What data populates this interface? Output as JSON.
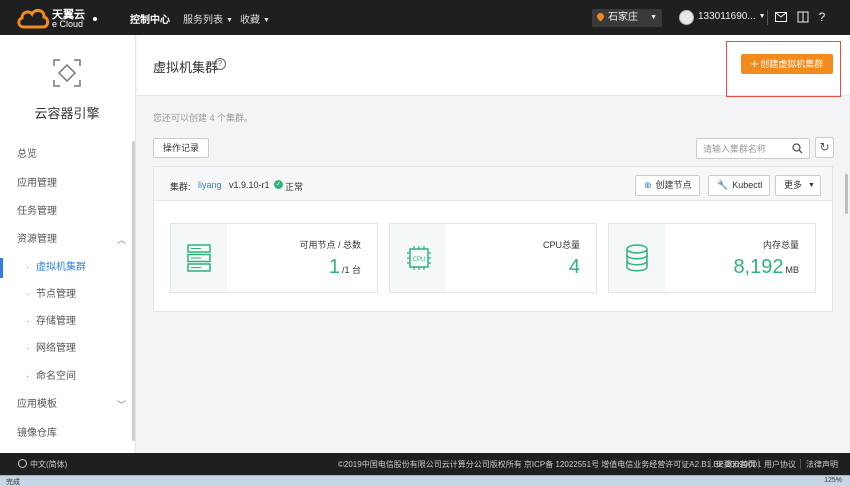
{
  "header": {
    "brand_cn": "天翼云",
    "brand_en": "e Cloud",
    "nav_console": "控制中心",
    "nav_services": "服务列表",
    "nav_favorites": "收藏",
    "region": "石家庄",
    "user": "133011690...",
    "icons": [
      "mail-icon",
      "book-icon",
      "help-icon"
    ]
  },
  "sidebar": {
    "title": "云容器引擎",
    "items": [
      {
        "label": "总览"
      },
      {
        "label": "应用管理"
      },
      {
        "label": "任务管理"
      },
      {
        "label": "资源管理",
        "expanded": true
      },
      {
        "label": "虚拟机集群",
        "active": true
      },
      {
        "label": "节点管理"
      },
      {
        "label": "存储管理"
      },
      {
        "label": "网络管理"
      },
      {
        "label": "命名空间"
      },
      {
        "label": "应用模板",
        "expanded": false
      },
      {
        "label": "镜像仓库"
      }
    ]
  },
  "page": {
    "title": "虚拟机集群",
    "create_button": "创建虚拟机集群",
    "quota_text": "您还可以创建 4 个集群。",
    "ops_log_button": "操作记录",
    "search_placeholder": "请输入集群名称"
  },
  "cluster": {
    "label": "集群:",
    "name": "liyang",
    "version": "v1.9.10-r1",
    "status": "正常",
    "btn_create_node": "创建节点",
    "btn_kubectl": "Kubectl",
    "btn_more": "更多",
    "stats": [
      {
        "label": "可用节点 / 总数",
        "value": "1",
        "unit": "/1 台",
        "icon": "server-icon"
      },
      {
        "label": "CPU总量",
        "value": "4",
        "unit": "",
        "icon": "cpu-icon"
      },
      {
        "label": "内存总量",
        "value": "8,192",
        "unit": "MB",
        "icon": "database-icon"
      }
    ]
  },
  "footer": {
    "language": "中文(简体)",
    "copyright": "©2019中国电信股份有限公司云计算分公司版权所有 京ICP备 12022551号 增值电信业务经营许可证A2.B1.B2-20090001",
    "links": [
      "天翼云首页",
      "用户协议",
      "法律声明"
    ]
  },
  "statusbar": {
    "left": "完成",
    "zoom": "125%"
  },
  "colors": {
    "accent_orange": "#f28a1e",
    "accent_blue": "#2f7fe0",
    "success_green": "#2fb37a",
    "topbar": "#1f1f1f"
  }
}
